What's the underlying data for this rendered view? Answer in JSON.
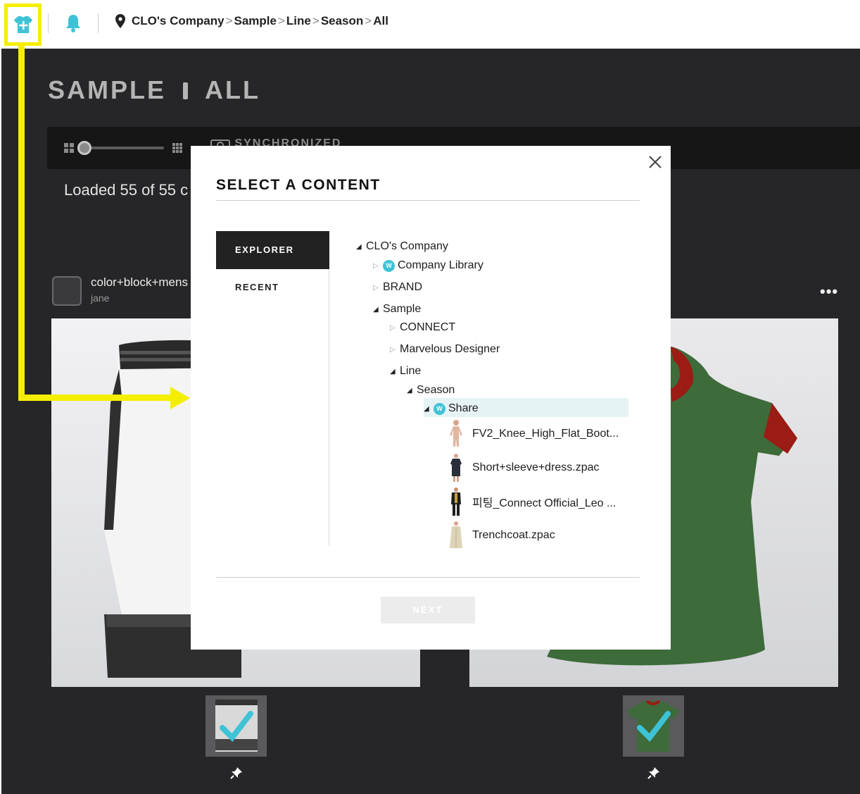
{
  "topbar": {
    "breadcrumbs": [
      "CLO's Company",
      "Sample",
      "Line",
      "Season",
      "All"
    ],
    "separator": ">"
  },
  "main": {
    "title_left": "SAMPLE",
    "title_right": "ALL",
    "sync_label": "SYNCHRONIZED",
    "loaded_text": "Loaded 55 of 55 c",
    "card": {
      "name": "color+block+mens",
      "user": "jane",
      "more": "•••"
    }
  },
  "modal": {
    "title": "SELECT A CONTENT",
    "tabs": {
      "explorer": "EXPLORER",
      "recent": "RECENT"
    },
    "next": "NEXT",
    "tree": {
      "root": "CLO's Company",
      "company_library": "Company Library",
      "brand": "BRAND",
      "sample": "Sample",
      "connect": "CONNECT",
      "marvelous": "Marvelous Designer",
      "line": "Line",
      "season": "Season",
      "share": "Share",
      "workspace_badge": "W",
      "files": [
        "FV2_Knee_High_Flat_Boot...",
        "Short+sleeve+dress.zpac",
        "피팅_Connect Official_Leo ...",
        "Trenchcoat.zpac"
      ]
    }
  },
  "colors": {
    "accent": "#3ec3d6",
    "highlight_yellow": "#f5ee00",
    "dark_bg": "#262628",
    "selection": "#e6f3f4"
  }
}
